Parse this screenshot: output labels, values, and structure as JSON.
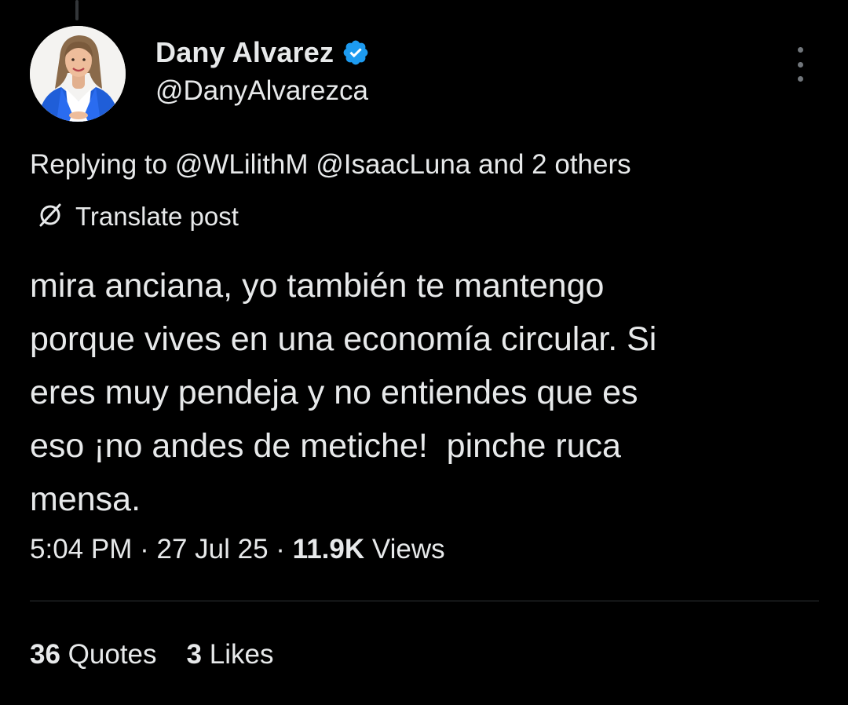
{
  "post": {
    "author": {
      "display_name": "Dany Alvarez",
      "handle": "@DanyAlvarezca",
      "verified_icon": "verified-badge-icon",
      "badge_color": "#1d9bf0"
    },
    "more_icon": "more-vertical-icon",
    "reply_context": {
      "prefix": "Replying to",
      "mention_1": "@WLilithM",
      "mention_2": "@IsaacLuna",
      "suffix": "and 2 others"
    },
    "translate": {
      "icon": "translate-icon",
      "label": "Translate post"
    },
    "text": "mira anciana, yo también te mantengo\nporque vives en una economía circular. Si\neres muy pendeja y no entiendes que es\neso ¡no andes de metiche!  pinche ruca\nmensa.",
    "meta": {
      "time": "5:04 PM",
      "separator": "·",
      "date": "27 Jul 25",
      "views_count": "11.9K",
      "views_label": "Views"
    },
    "stats": {
      "quotes_count": "36",
      "quotes_label": "Quotes",
      "likes_count": "3",
      "likes_label": "Likes"
    }
  },
  "colors": {
    "background": "#000000",
    "text": "#e7e9ea",
    "secondary": "#71767b",
    "divider": "#2f3336",
    "accent": "#1d9bf0"
  }
}
